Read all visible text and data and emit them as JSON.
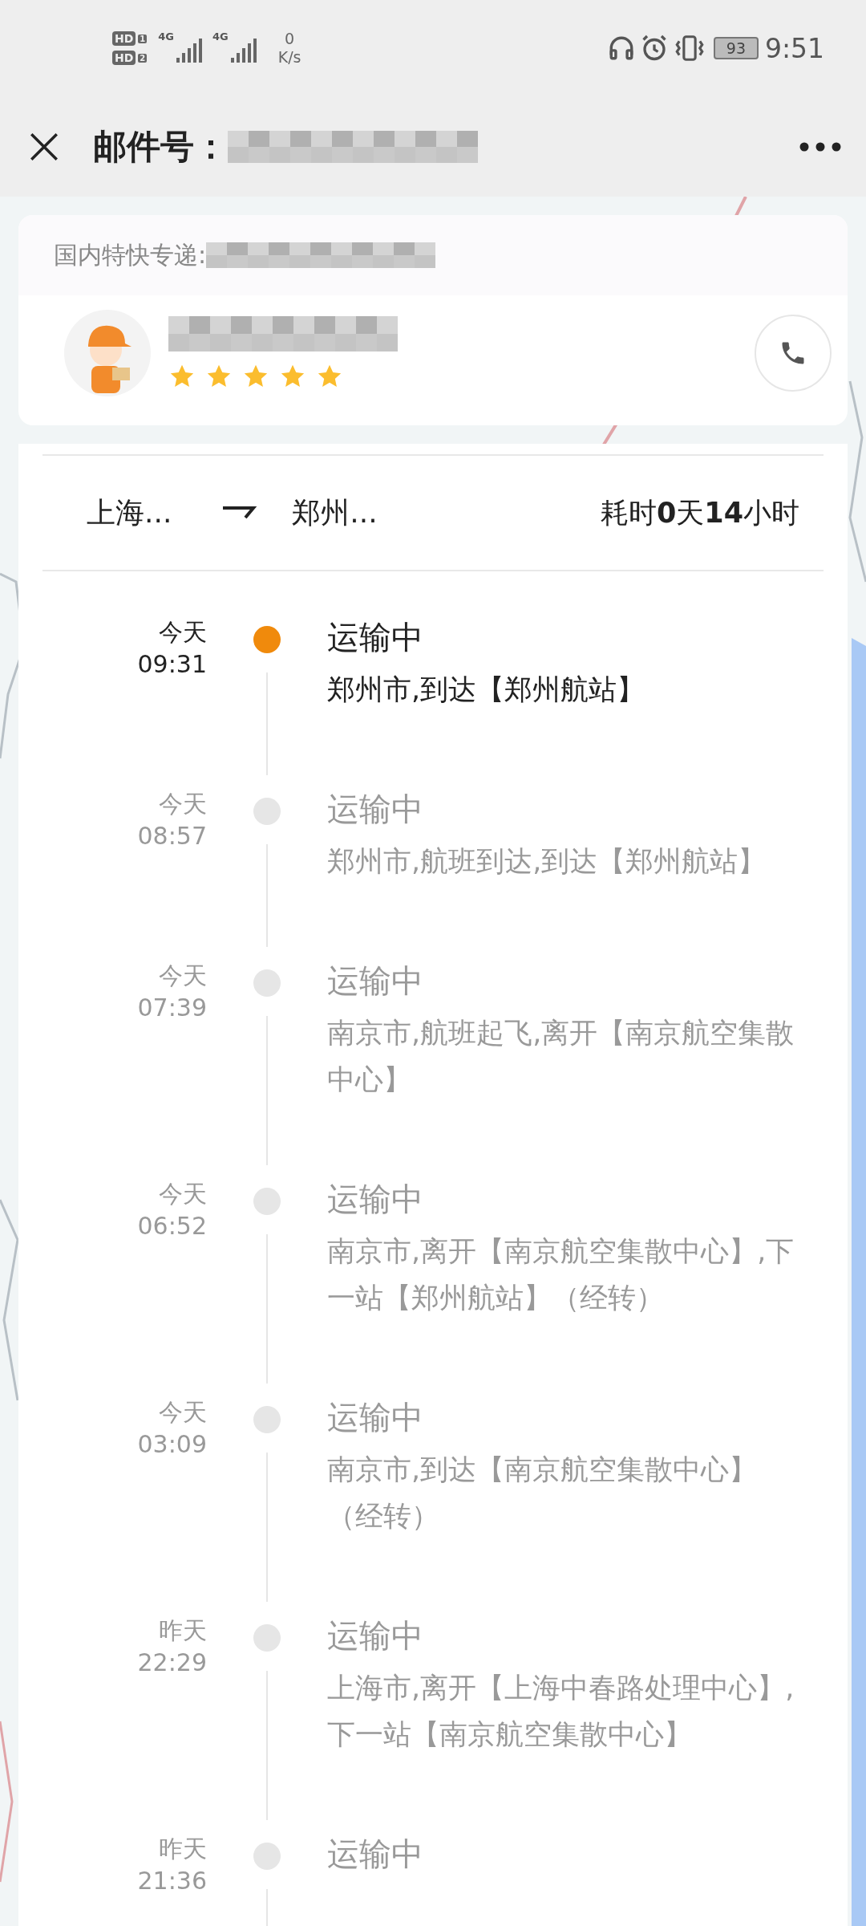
{
  "status_bar": {
    "sims": [
      {
        "label": "HD",
        "slot": "1"
      },
      {
        "label": "HD",
        "slot": "2"
      }
    ],
    "networks": [
      "4G",
      "4G"
    ],
    "speed_value": "0",
    "speed_unit": "K/s",
    "battery": "93",
    "time": "9:51"
  },
  "header": {
    "title": "邮件号："
  },
  "courier": {
    "service_label": "国内特快专递:",
    "stars": 5
  },
  "route": {
    "origin": "上海...",
    "destination": "郑州...",
    "duration": "耗时**0**天**14**小时"
  },
  "events": [
    {
      "day": "今天",
      "time": "09:31",
      "status": "运输中",
      "detail": "郑州市,到达【郑州航站】",
      "current": true
    },
    {
      "day": "今天",
      "time": "08:57",
      "status": "运输中",
      "detail": "郑州市,航班到达,到达【郑州航站】",
      "current": false
    },
    {
      "day": "今天",
      "time": "07:39",
      "status": "运输中",
      "detail": "南京市,航班起飞,离开【南京航空集散中心】",
      "current": false
    },
    {
      "day": "今天",
      "time": "06:52",
      "status": "运输中",
      "detail": "南京市,离开【南京航空集散中心】,下一站【郑州航站】（经转）",
      "current": false
    },
    {
      "day": "今天",
      "time": "03:09",
      "status": "运输中",
      "detail": "南京市,到达【南京航空集散中心】（经转）",
      "current": false
    },
    {
      "day": "昨天",
      "time": "22:29",
      "status": "运输中",
      "detail": "上海市,离开【上海中春路处理中心】,下一站【南京航空集散中心】",
      "current": false
    },
    {
      "day": "昨天",
      "time": "21:36",
      "status": "运输中",
      "current": false
    }
  ]
}
